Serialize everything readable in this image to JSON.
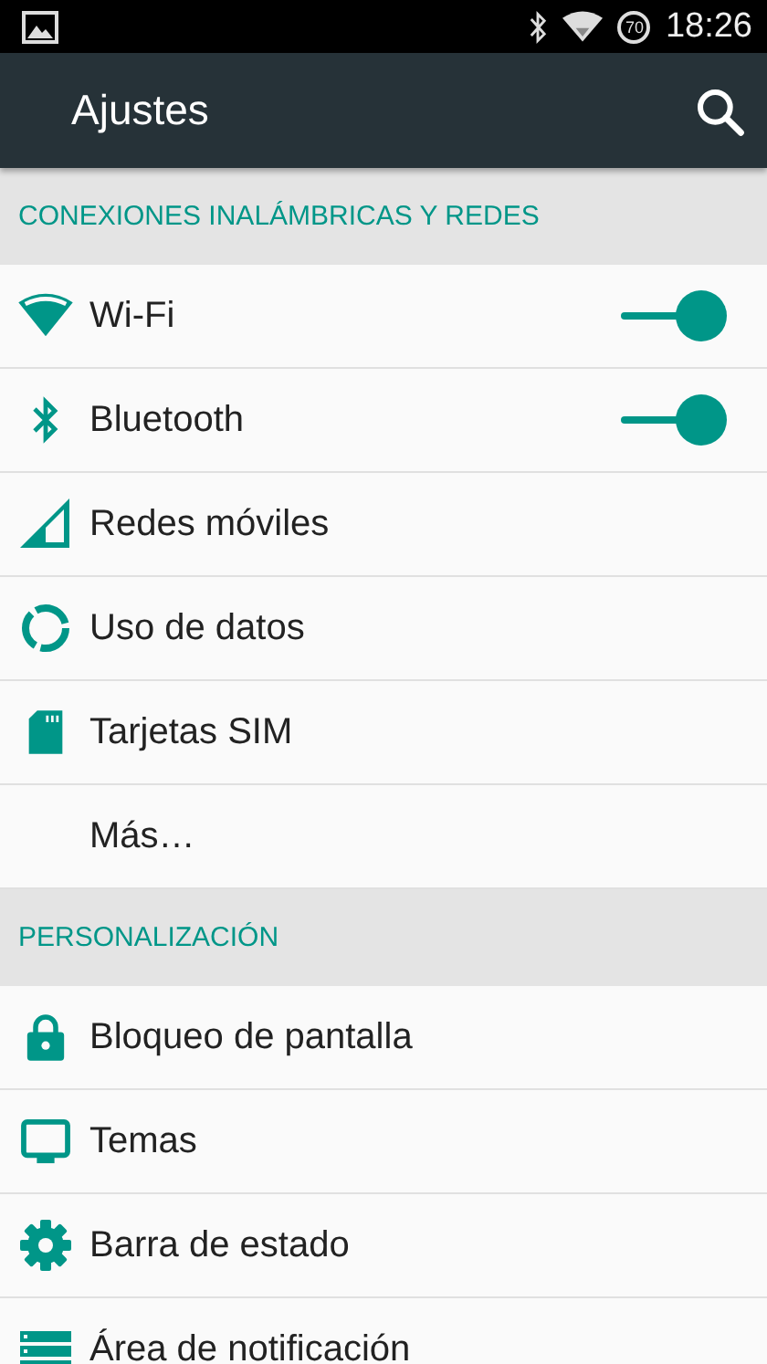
{
  "status_bar": {
    "battery": "70",
    "time": "18:26"
  },
  "app_bar": {
    "title": "Ajustes"
  },
  "sections": [
    {
      "header": "CONEXIONES INALÁMBRICAS Y REDES",
      "items": [
        {
          "label": "Wi-Fi",
          "kind": "toggle",
          "on": true
        },
        {
          "label": "Bluetooth",
          "kind": "toggle",
          "on": true
        },
        {
          "label": "Redes móviles",
          "kind": "link"
        },
        {
          "label": "Uso de datos",
          "kind": "link"
        },
        {
          "label": "Tarjetas SIM",
          "kind": "link"
        },
        {
          "label": "Más…",
          "kind": "link"
        }
      ]
    },
    {
      "header": "PERSONALIZACIÓN",
      "items": [
        {
          "label": "Bloqueo de pantalla",
          "kind": "link"
        },
        {
          "label": "Temas",
          "kind": "link"
        },
        {
          "label": "Barra de estado",
          "kind": "link"
        },
        {
          "label": "Área de notificación",
          "kind": "link"
        }
      ]
    }
  ]
}
